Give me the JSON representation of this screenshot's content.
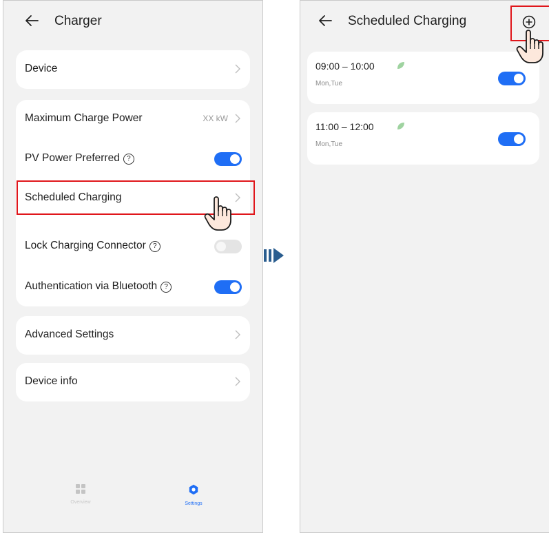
{
  "left_screen": {
    "title": "Charger",
    "rows": [
      {
        "label": "Device"
      },
      {
        "label": "Maximum Charge Power",
        "value": "XX kW"
      },
      {
        "label": "PV Power Preferred",
        "toggle": true
      },
      {
        "label": "Scheduled Charging"
      },
      {
        "label": "Lock Charging Connector",
        "toggle": false
      },
      {
        "label": "Authentication via Bluetooth",
        "toggle": true
      },
      {
        "label": "Advanced Settings"
      },
      {
        "label": "Device info"
      }
    ],
    "help_symbol": "?",
    "nav": [
      {
        "label": "Overview",
        "icon": "grid-icon"
      },
      {
        "label": "Settings",
        "icon": "gear-icon",
        "active": true
      }
    ]
  },
  "right_screen": {
    "title": "Scheduled Charging",
    "add_icon": "plus-circle-icon",
    "schedules": [
      {
        "time": "09:00 – 10:00",
        "days": "Mon,Tue",
        "enabled": true
      },
      {
        "time": "11:00 – 12:00",
        "days": "Mon,Tue",
        "enabled": true
      }
    ]
  },
  "colors": {
    "accent": "#1f6ef5",
    "highlight": "#e0161b",
    "arrow": "#2a5d8f",
    "leaf": "#9fd3a0"
  }
}
